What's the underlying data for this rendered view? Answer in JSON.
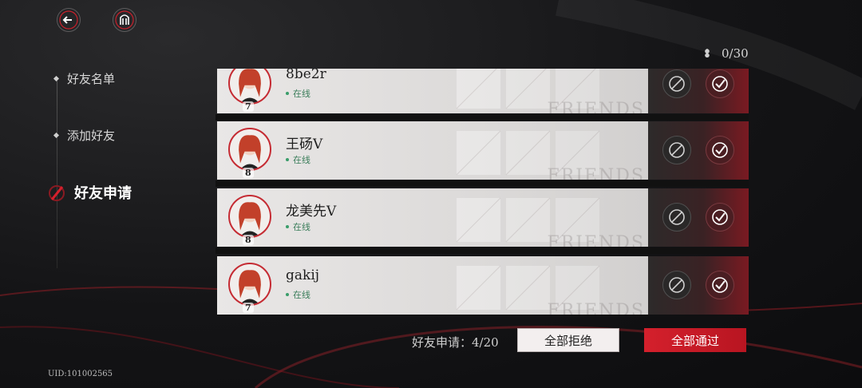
{
  "nav": {
    "items": [
      {
        "label": "好友名单",
        "active": false
      },
      {
        "label": "添加好友",
        "active": false
      },
      {
        "label": "好友申请",
        "active": true
      }
    ]
  },
  "uid": "UID:101002565",
  "counter": {
    "icon": "rose-icon",
    "value": "0/30"
  },
  "requests": [
    {
      "name": "8be2r",
      "status": "在线",
      "level": "7"
    },
    {
      "name": "王砀V",
      "status": "在线",
      "level": "8"
    },
    {
      "name": "龙美先V",
      "status": "在线",
      "level": "8"
    },
    {
      "name": "gakij",
      "status": "在线",
      "level": "7"
    }
  ],
  "card_watermark": "FRIENDS",
  "footer": {
    "request_count": "好友申请：4/20",
    "reject_all": "全部拒绝",
    "accept_all": "全部通过"
  },
  "colors": {
    "accent": "#c8202b",
    "online": "#3a7d5a"
  }
}
